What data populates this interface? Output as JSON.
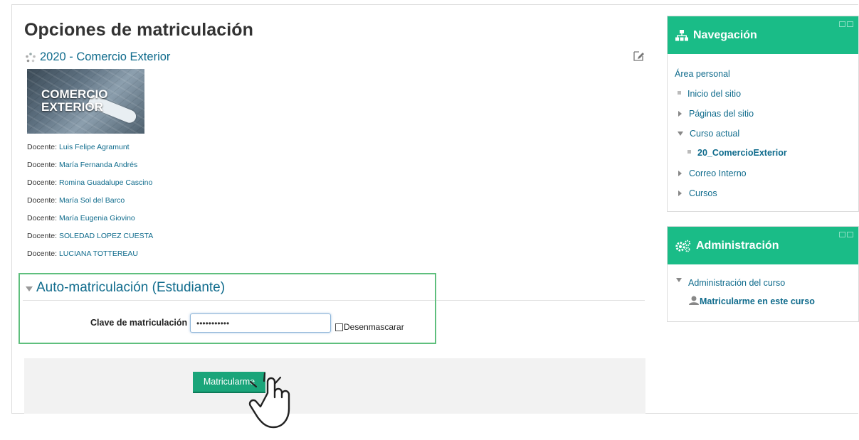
{
  "page": {
    "title": "Opciones de matriculación",
    "course_name": "2020 - Comercio Exterior",
    "course_image_text_1": "COMERCIO",
    "course_image_text_2": "EXTERIOR"
  },
  "teachers": [
    {
      "role": "Docente: ",
      "name": "Luis Felipe Agramunt"
    },
    {
      "role": "Docente: ",
      "name": "María Fernanda Andrés"
    },
    {
      "role": "Docente: ",
      "name": "Romina Guadalupe Cascino"
    },
    {
      "role": "Docente: ",
      "name": "María Sol del Barco"
    },
    {
      "role": "Docente: ",
      "name": "María Eugenia Giovino"
    },
    {
      "role": "Docente: ",
      "name": "SOLEDAD LOPEZ CUESTA"
    },
    {
      "role": "Docente: ",
      "name": "LUCIANA TOTTEREAU"
    }
  ],
  "self_enrol": {
    "section_title": "Auto-matriculación (Estudiante)",
    "key_label": "Clave de matriculación",
    "key_value": "•••••••••••",
    "unmask_label": "Desenmascarar",
    "submit_label": "Matricularme"
  },
  "navigation": {
    "title": "Navegación",
    "items": [
      {
        "label": "Área personal"
      },
      {
        "label": "Inicio del sitio"
      },
      {
        "label": "Páginas del sitio"
      },
      {
        "label": "Curso actual"
      },
      {
        "label": "20_ComercioExterior"
      },
      {
        "label": "Correo Interno"
      },
      {
        "label": "Cursos"
      }
    ]
  },
  "administration": {
    "title": "Administración",
    "items": [
      {
        "label": "Administración del curso"
      },
      {
        "label": "Matricularme en este curso"
      }
    ]
  },
  "colors": {
    "accent": "#1abc87",
    "link": "#0f6b8c",
    "button": "#1aa57a",
    "section_border": "#5fbf7d"
  }
}
